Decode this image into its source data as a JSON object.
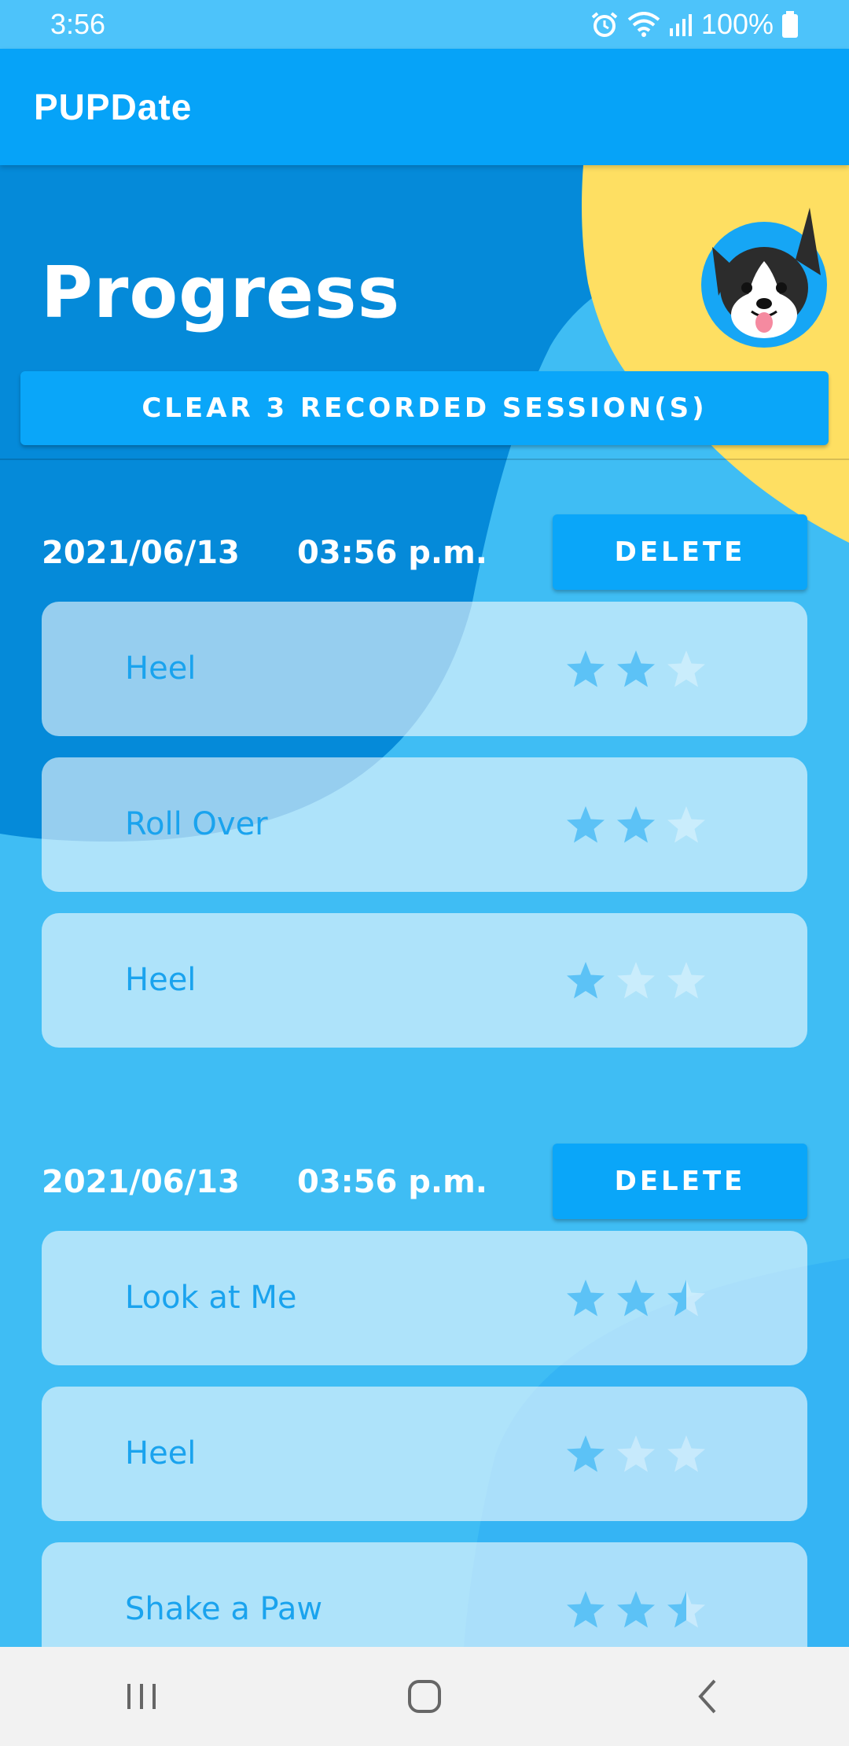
{
  "status_bar": {
    "time": "3:56",
    "battery": "100%"
  },
  "app_bar": {
    "title": "PUPDate"
  },
  "page": {
    "heading": "Progress",
    "clear_button": "CLEAR 3 RECORDED SESSION(S)"
  },
  "colors": {
    "primary": "#06a3f8",
    "background": "#3fbdf4",
    "accent_yellow": "#fedf62",
    "star_filled": "#5cc2f6"
  },
  "sessions": [
    {
      "date": "2021/06/13",
      "time": "03:56 p.m.",
      "delete_label": "DELETE",
      "items": [
        {
          "name": "Heel",
          "rating": 2,
          "max": 3
        },
        {
          "name": "Roll Over",
          "rating": 2,
          "max": 3
        },
        {
          "name": "Heel",
          "rating": 1,
          "max": 3
        }
      ]
    },
    {
      "date": "2021/06/13",
      "time": "03:56 p.m.",
      "delete_label": "DELETE",
      "items": [
        {
          "name": "Look at Me",
          "rating": 2.5,
          "max": 3
        },
        {
          "name": "Heel",
          "rating": 1,
          "max": 3
        },
        {
          "name": "Shake a Paw",
          "rating": 2.5,
          "max": 3
        }
      ]
    }
  ],
  "nav_bar": {
    "icons": [
      "recents-icon",
      "home-icon",
      "back-icon"
    ]
  }
}
